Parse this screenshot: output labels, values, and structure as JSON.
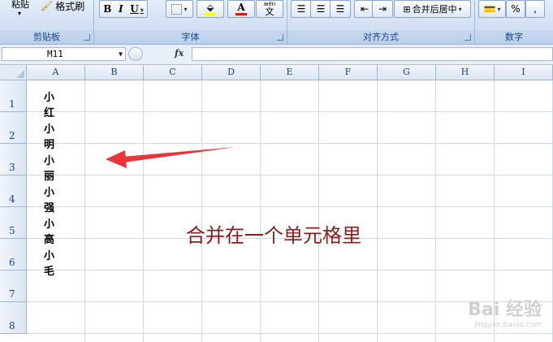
{
  "ribbon": {
    "paste_label": "粘贴",
    "format_painter_label": "格式刷",
    "groups": {
      "clipboard": "剪贴板",
      "font": "字体",
      "alignment": "对齐方式",
      "number": "数字"
    },
    "font_buttons": {
      "bold": "B",
      "italic": "I",
      "underline": "U",
      "font_color": "A",
      "phonetic": "文"
    },
    "merge_center_label": "合并后居中",
    "number_buttons": {
      "percent": "%",
      "comma": ","
    },
    "colors": {
      "font_color_bar": "#e51400",
      "highlight_bar": "#ffff00"
    }
  },
  "formula_bar": {
    "name_box": "M11",
    "fx_label": "fx",
    "formula": ""
  },
  "sheet": {
    "columns": [
      "A",
      "B",
      "C",
      "D",
      "E",
      "F",
      "G",
      "H",
      "I"
    ],
    "rows": [
      "1",
      "2",
      "3",
      "4",
      "5",
      "6",
      "7",
      "8"
    ],
    "a_values": [
      "小红",
      "小明",
      "小丽",
      "小强",
      "小高",
      "小毛"
    ]
  },
  "annotation": {
    "text": "合并在一个单元格里",
    "arrow_color": "#e8343a",
    "text_color": "#8b1c1c"
  },
  "watermark": {
    "brand": "Bai 经验",
    "url": "jingyan.baidu.com"
  }
}
